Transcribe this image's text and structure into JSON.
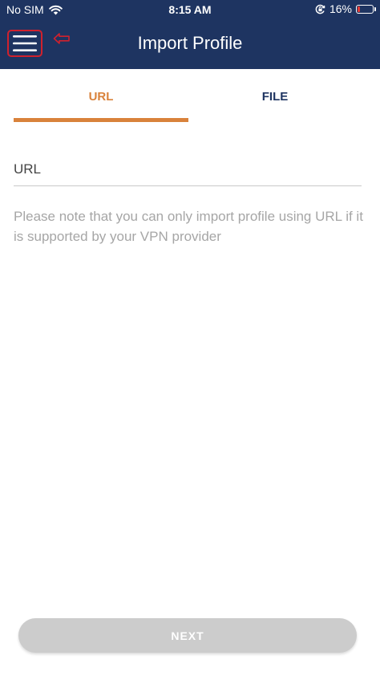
{
  "status_bar": {
    "carrier": "No SIM",
    "time": "8:15 AM",
    "battery_percent": "16%",
    "battery_level": 0.16,
    "battery_color": "#e53935",
    "icons": [
      "wifi-icon",
      "orientation-lock-icon",
      "battery-icon"
    ]
  },
  "header": {
    "title": "Import Profile",
    "background_color": "#1e3461",
    "menu_icon": "hamburger-menu-icon",
    "highlight_color": "#d0212d",
    "indicator_icon": "arrow-left-icon"
  },
  "tabs": [
    {
      "label": "URL",
      "active": true,
      "color": "#d9823b"
    },
    {
      "label": "FILE",
      "active": false,
      "color": "#1e3461"
    }
  ],
  "form": {
    "url_placeholder": "URL",
    "url_value": "",
    "note": "Please note that you can only import profile using URL if it is supported by your VPN provider"
  },
  "footer": {
    "next_label": "NEXT",
    "next_color": "#cccccc"
  }
}
